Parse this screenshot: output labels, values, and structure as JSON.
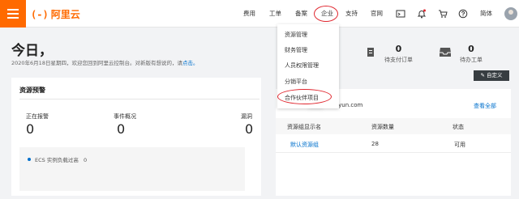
{
  "brand": {
    "logo_mark": "(-)",
    "logo_text": "阿里云",
    "accent": "#ff6a00"
  },
  "nav": {
    "fee": "费用",
    "ticket": "工单",
    "filing": "备案",
    "enterprise": "企业",
    "support": "支持",
    "website": "官网",
    "language": "简体"
  },
  "icons": [
    "menu-icon",
    "terminal-icon",
    "bell-icon",
    "cart-icon",
    "help-icon"
  ],
  "annotation_color": "#e0262e",
  "enterprise_menu": [
    {
      "label": "资源管理"
    },
    {
      "label": "财务管理"
    },
    {
      "label": "人员权限管理"
    },
    {
      "label": "分销平台"
    },
    {
      "label": "合作伙伴项目"
    }
  ],
  "welcome": {
    "title": "今日，",
    "subtitle_prefix": "2020年6月18日星期四，欢迎您回到阿里云控制台。对新版有想说的，请",
    "subtitle_link": "点击。"
  },
  "stats": [
    {
      "value": "0",
      "label": "待支付订单"
    },
    {
      "value": "0",
      "label": "待办工单"
    }
  ],
  "customize_label": "自定义",
  "resource_alerts": {
    "title": "资源预警",
    "columns": [
      {
        "label": "正在报警",
        "value": "0"
      },
      {
        "label": "事件概况",
        "value": "0"
      },
      {
        "label": "漏洞",
        "value": "0"
      }
    ],
    "alert_item": "ECS 实例负载过高",
    "alert_count": "0"
  },
  "resource_groups": {
    "domain": ".onaliyun.com",
    "view_all": "查看全部",
    "headers": [
      "资源组显示名",
      "资源数量",
      "状态"
    ],
    "rows": [
      {
        "name": "默认资源组",
        "count": "28",
        "status": "可用"
      }
    ]
  }
}
